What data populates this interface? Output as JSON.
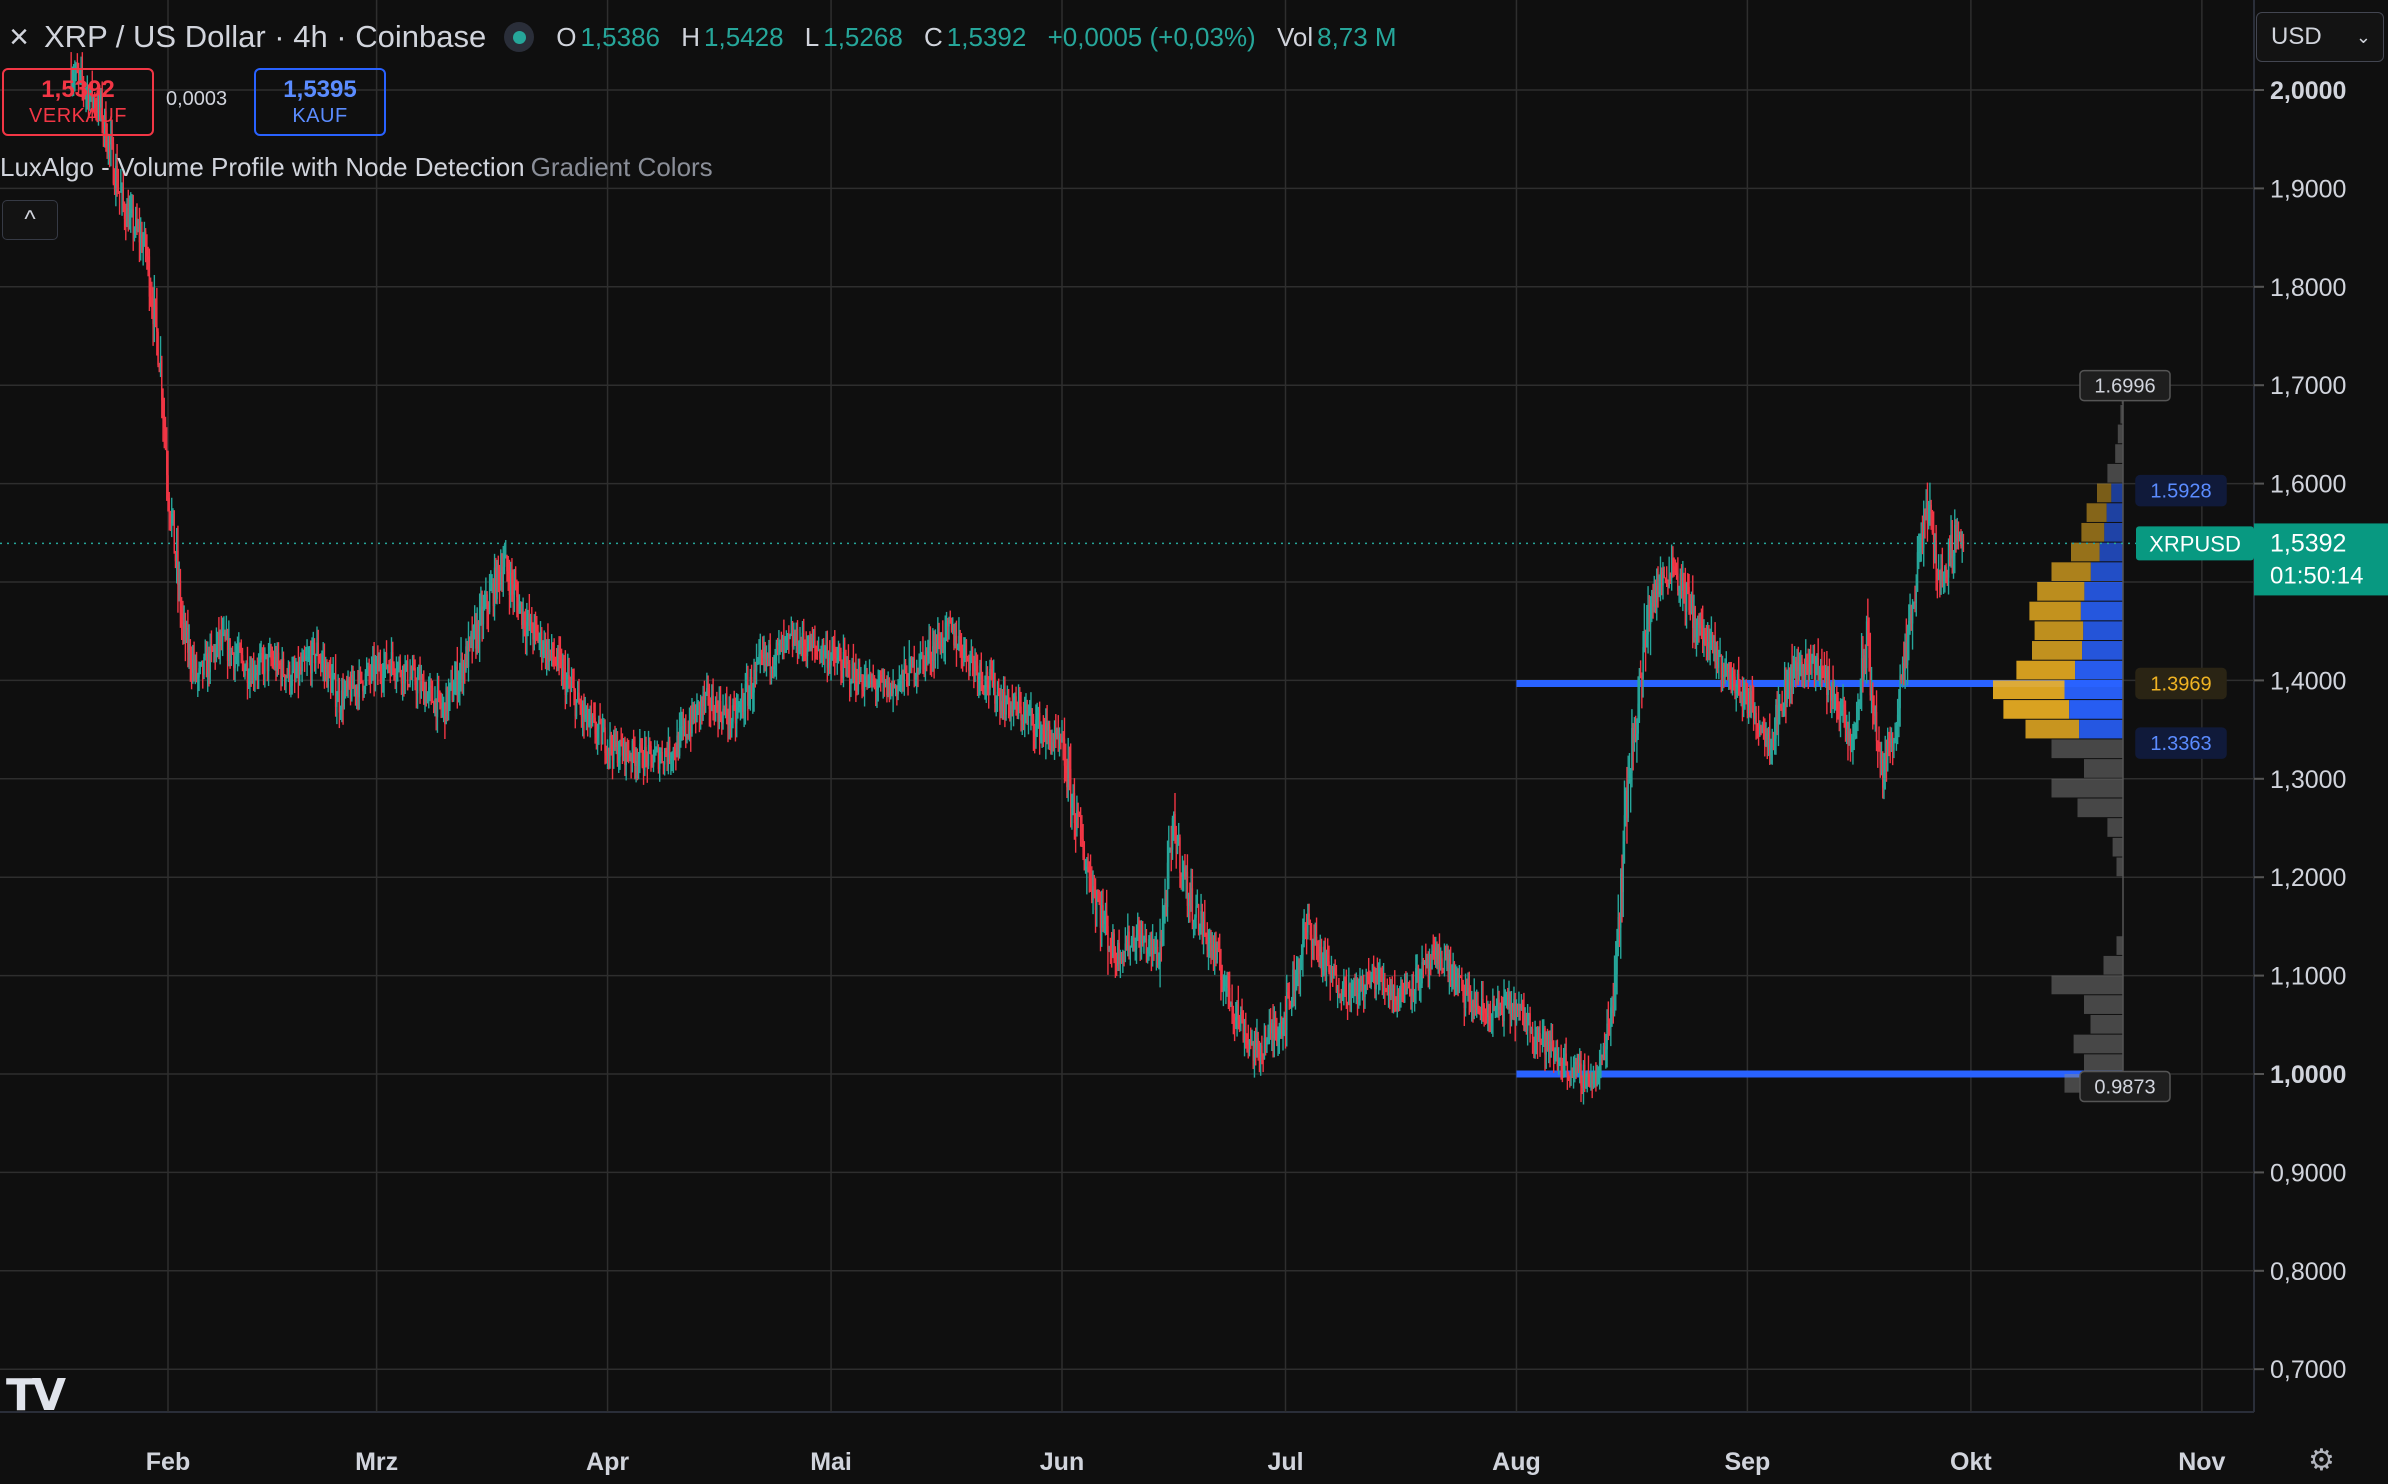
{
  "header": {
    "close_icon": "×",
    "symbol_title": "XRP / US Dollar · 4h · Coinbase",
    "ohlc": {
      "o_label": "O",
      "o_value": "1,5386",
      "h_label": "H",
      "h_value": "1,5428",
      "l_label": "L",
      "l_value": "1,5268",
      "c_label": "C",
      "c_value": "1,5392",
      "change": "+0,0005 (+0,03%)",
      "vol_label": "Vol",
      "vol_value": "8,73 M"
    }
  },
  "trade": {
    "sell_price": "1,5392",
    "sell_label": "VERKAUF",
    "spread": "0,0003",
    "buy_price": "1,5395",
    "buy_label": "KAUF"
  },
  "indicator": {
    "name": "LuxAlgo - Volume Profile with Node Detection",
    "style": "Gradient Colors",
    "collapse_icon": "^"
  },
  "currency": {
    "value": "USD",
    "chevron": "⌄"
  },
  "logo": {
    "text": "TV"
  },
  "settings_icon": "⚙",
  "colors": {
    "bg": "#0f0f0f",
    "up": "#26a69a",
    "down": "#f23645",
    "grid": "#2e2e2e",
    "accent": "#2962ff",
    "poc": "#f0b323"
  },
  "chart_data": {
    "type": "candlestick",
    "symbol": "XRPUSD",
    "y_axis": {
      "range": [
        0.66,
        2.09
      ],
      "ticks": [
        0.7,
        0.8,
        0.9,
        1.0,
        1.1,
        1.2,
        1.3,
        1.4,
        1.5,
        1.6,
        1.7,
        1.8,
        1.9,
        2.0
      ],
      "tick_labels": [
        "0,7000",
        "0,8000",
        "0,9000",
        "1,0000",
        "1,1000",
        "1,2000",
        "1,3000",
        "1,4000",
        "1,5000",
        "1,6000",
        "1,7000",
        "1,8000",
        "1,9000",
        "2,0000"
      ]
    },
    "x_axis": {
      "range": [
        "2025-01-19",
        "2025-11-01"
      ],
      "ticks": [
        "2025-02-01",
        "2025-03-01",
        "2025-04-01",
        "2025-05-01",
        "2025-06-01",
        "2025-07-01",
        "2025-08-01",
        "2025-09-01",
        "2025-10-01",
        "2025-11-01"
      ],
      "tick_labels": [
        "Feb",
        "Mrz",
        "Apr",
        "Mai",
        "Jun",
        "Jul",
        "Aug",
        "Sep",
        "Okt",
        "Nov"
      ]
    },
    "price_path": [
      [
        "2025-01-19",
        2.02
      ],
      [
        "2025-01-23",
        1.98
      ],
      [
        "2025-01-26",
        1.88
      ],
      [
        "2025-01-29",
        1.84
      ],
      [
        "2025-01-31",
        1.72
      ],
      [
        "2025-02-01",
        1.6
      ],
      [
        "2025-02-03",
        1.45
      ],
      [
        "2025-02-05",
        1.4
      ],
      [
        "2025-02-08",
        1.44
      ],
      [
        "2025-02-12",
        1.41
      ],
      [
        "2025-02-15",
        1.42
      ],
      [
        "2025-02-18",
        1.4
      ],
      [
        "2025-02-21",
        1.43
      ],
      [
        "2025-02-24",
        1.38
      ],
      [
        "2025-02-27",
        1.4
      ],
      [
        "2025-03-03",
        1.42
      ],
      [
        "2025-03-06",
        1.4
      ],
      [
        "2025-03-10",
        1.37
      ],
      [
        "2025-03-14",
        1.44
      ],
      [
        "2025-03-18",
        1.52
      ],
      [
        "2025-03-21",
        1.46
      ],
      [
        "2025-03-25",
        1.42
      ],
      [
        "2025-03-29",
        1.36
      ],
      [
        "2025-04-02",
        1.33
      ],
      [
        "2025-04-07",
        1.32
      ],
      [
        "2025-04-10",
        1.33
      ],
      [
        "2025-04-14",
        1.38
      ],
      [
        "2025-04-18",
        1.36
      ],
      [
        "2025-04-22",
        1.42
      ],
      [
        "2025-04-26",
        1.44
      ],
      [
        "2025-04-30",
        1.43
      ],
      [
        "2025-05-05",
        1.4
      ],
      [
        "2025-05-09",
        1.39
      ],
      [
        "2025-05-13",
        1.42
      ],
      [
        "2025-05-17",
        1.45
      ],
      [
        "2025-05-20",
        1.42
      ],
      [
        "2025-05-24",
        1.38
      ],
      [
        "2025-05-28",
        1.36
      ],
      [
        "2025-06-01",
        1.33
      ],
      [
        "2025-06-04",
        1.22
      ],
      [
        "2025-06-08",
        1.12
      ],
      [
        "2025-06-11",
        1.14
      ],
      [
        "2025-06-14",
        1.12
      ],
      [
        "2025-06-16",
        1.25
      ],
      [
        "2025-06-18",
        1.18
      ],
      [
        "2025-06-21",
        1.13
      ],
      [
        "2025-06-24",
        1.07
      ],
      [
        "2025-06-27",
        1.02
      ],
      [
        "2025-07-01",
        1.06
      ],
      [
        "2025-07-04",
        1.15
      ],
      [
        "2025-07-07",
        1.1
      ],
      [
        "2025-07-10",
        1.08
      ],
      [
        "2025-07-13",
        1.1
      ],
      [
        "2025-07-16",
        1.08
      ],
      [
        "2025-07-19",
        1.1
      ],
      [
        "2025-07-22",
        1.12
      ],
      [
        "2025-07-25",
        1.08
      ],
      [
        "2025-07-28",
        1.06
      ],
      [
        "2025-07-31",
        1.07
      ],
      [
        "2025-08-03",
        1.05
      ],
      [
        "2025-08-06",
        1.02
      ],
      [
        "2025-08-09",
        1.0
      ],
      [
        "2025-08-12",
        0.995
      ],
      [
        "2025-08-14",
        1.08
      ],
      [
        "2025-08-16",
        1.3
      ],
      [
        "2025-08-19",
        1.48
      ],
      [
        "2025-08-22",
        1.52
      ],
      [
        "2025-08-25",
        1.46
      ],
      [
        "2025-08-28",
        1.42
      ],
      [
        "2025-09-01",
        1.38
      ],
      [
        "2025-09-04",
        1.34
      ],
      [
        "2025-09-07",
        1.41
      ],
      [
        "2025-09-10",
        1.42
      ],
      [
        "2025-09-13",
        1.38
      ],
      [
        "2025-09-15",
        1.33
      ],
      [
        "2025-09-17",
        1.44
      ],
      [
        "2025-09-19",
        1.3
      ],
      [
        "2025-09-21",
        1.36
      ],
      [
        "2025-09-23",
        1.46
      ],
      [
        "2025-09-25",
        1.58
      ],
      [
        "2025-09-27",
        1.5
      ],
      [
        "2025-09-29",
        1.55
      ],
      [
        "2025-09-30",
        1.5392
      ]
    ],
    "current_price": {
      "label": "XRPUSD",
      "value": "1,5392",
      "countdown": "01:50:14",
      "price": 1.5392
    },
    "volume_profile": {
      "range_start": "2025-08-01",
      "high": 1.6996,
      "low": 0.9873,
      "value_area_high": 1.5928,
      "poc": 1.3969,
      "value_area_low": 1.3363,
      "labels": {
        "high": "1.6996",
        "vah": "1.5928",
        "poc": "1.3969",
        "val": "1.3363",
        "low": "0.9873"
      },
      "levels": [
        0.99,
        1.01,
        1.03,
        1.05,
        1.07,
        1.09,
        1.11,
        1.13,
        1.15,
        1.17,
        1.19,
        1.21,
        1.23,
        1.25,
        1.27,
        1.29,
        1.31,
        1.33,
        1.35,
        1.37,
        1.39,
        1.41,
        1.43,
        1.45,
        1.47,
        1.49,
        1.51,
        1.53,
        1.55,
        1.57,
        1.59,
        1.61,
        1.63,
        1.65,
        1.67,
        1.69
      ],
      "volumes": [
        0.45,
        0.3,
        0.38,
        0.25,
        0.3,
        0.55,
        0.15,
        0.05,
        0.0,
        0.0,
        0.0,
        0.05,
        0.08,
        0.12,
        0.35,
        0.55,
        0.3,
        0.55,
        0.75,
        0.92,
        1.0,
        0.82,
        0.7,
        0.68,
        0.72,
        0.66,
        0.55,
        0.4,
        0.32,
        0.28,
        0.2,
        0.12,
        0.06,
        0.04,
        0.02,
        0.01
      ]
    }
  }
}
